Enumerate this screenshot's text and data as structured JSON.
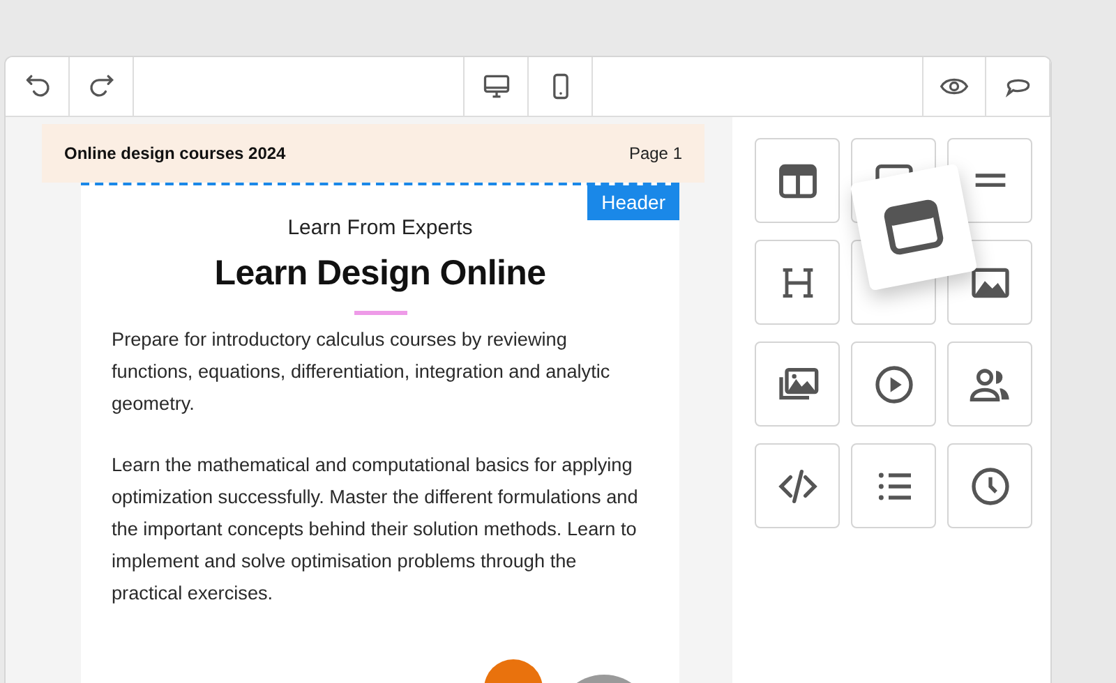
{
  "banner": {
    "title": "Online design courses 2024",
    "page_label": "Page 1"
  },
  "section_tag": "Header",
  "page": {
    "eyebrow": "Learn From Experts",
    "title": "Learn Design Online",
    "paragraphs": [
      "Prepare for introductory calculus courses by reviewing functions, equations, differentiation, integration and analytic geometry.",
      "Learn the mathematical and computational basics for applying optimization successfully. Master the different formulations and the important concepts behind their solution methods. Learn to implement and solve optimisation problems through the practical exercises."
    ]
  }
}
